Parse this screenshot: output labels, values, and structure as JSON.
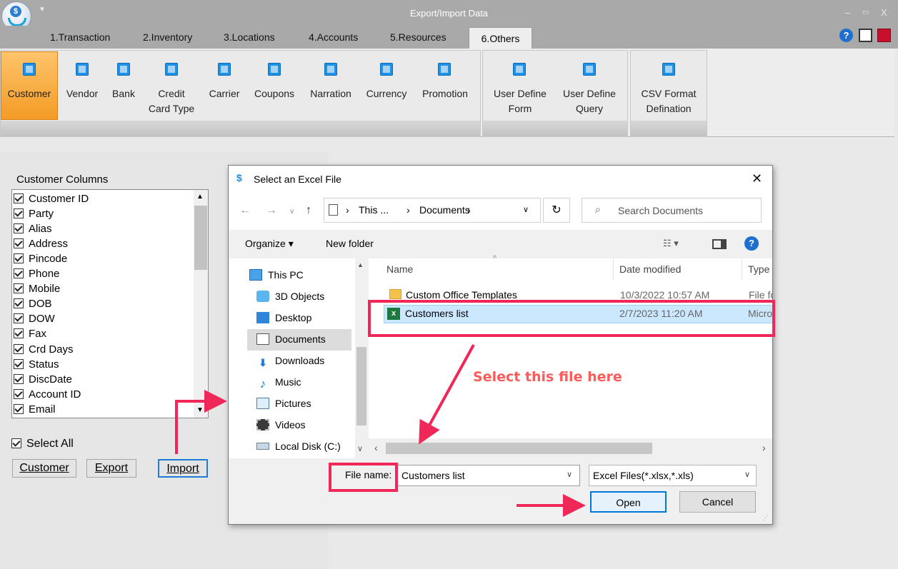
{
  "window": {
    "title": "Export/Import Data",
    "controls": [
      "–",
      "▭",
      "X"
    ]
  },
  "tabs": [
    "1.Transaction",
    "2.Inventory",
    "3.Locations",
    "4.Accounts",
    "5.Resources",
    "6.Others"
  ],
  "ribbon": {
    "group1": [
      "Customer",
      "Vendor",
      "Bank",
      "Credit",
      "Card Type",
      "Carrier",
      "Coupons",
      "Narration",
      "Currency",
      "Promotion"
    ],
    "group2": [
      "User Define",
      "Form",
      "User Define",
      "Query"
    ],
    "group3": [
      "CSV Format",
      "Defination"
    ]
  },
  "left_panel": {
    "columns_label": "Customer Columns",
    "columns": [
      "Customer ID",
      "Party",
      "Alias",
      "Address",
      "Pincode",
      "Phone",
      "Mobile",
      "DOB",
      "DOW",
      "Fax",
      "Crd Days",
      "Status",
      "DiscDate",
      "Account ID",
      "Email"
    ],
    "select_all": "Select All",
    "buttons": [
      "Customer",
      "Export",
      "Import"
    ]
  },
  "dialog": {
    "title": "Select an Excel File",
    "breadcrumb": [
      "This ...",
      "Documents"
    ],
    "search_placeholder": "Search Documents",
    "organize": "Organize ▾",
    "new_folder": "New folder",
    "nav": [
      "This PC",
      "3D Objects",
      "Desktop",
      "Documents",
      "Downloads",
      "Music",
      "Pictures",
      "Videos",
      "Local Disk (C:)"
    ],
    "columns": [
      "Name",
      "Date modified",
      "Type"
    ],
    "files": [
      {
        "name": "Custom Office Templates",
        "date": "10/3/2022 10:57 AM",
        "type": "File fo"
      },
      {
        "name": "Customers list",
        "date": "2/7/2023 11:20 AM",
        "type": "Micro"
      }
    ],
    "file_name_label": "File name:",
    "file_name_value": "Customers list",
    "filter": "Excel Files(*.xlsx,*.xls)",
    "open": "Open",
    "cancel": "Cancel"
  },
  "annotation": "Select this file here",
  "colors": {
    "accent_red": "#f0285a",
    "selection": "#cce8ff",
    "customer_btn": "#f39b26"
  }
}
